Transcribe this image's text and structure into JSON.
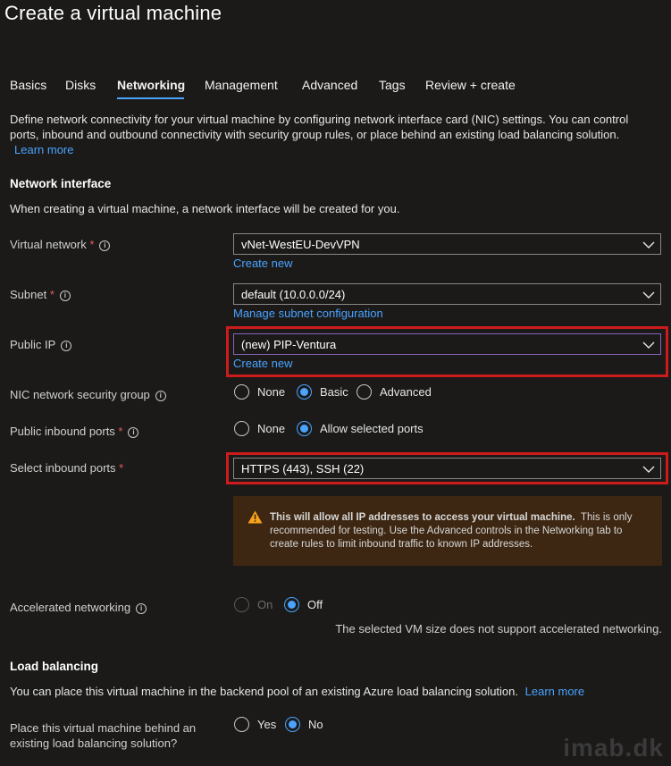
{
  "page": {
    "title": "Create a virtual machine"
  },
  "tabs": [
    {
      "label": "Basics"
    },
    {
      "label": "Disks"
    },
    {
      "label": "Networking"
    },
    {
      "label": "Management"
    },
    {
      "label": "Advanced"
    },
    {
      "label": "Tags"
    },
    {
      "label": "Review + create"
    }
  ],
  "intro": {
    "text": "Define network connectivity for your virtual machine by configuring network interface card (NIC) settings. You can control ports, inbound and outbound connectivity with security group rules, or place behind an existing load balancing solution.",
    "learn_more": "Learn more"
  },
  "network_interface": {
    "heading": "Network interface",
    "description": "When creating a virtual machine, a network interface will be created for you.",
    "virtual_network": {
      "label": "Virtual network",
      "value": "vNet-WestEU-DevVPN",
      "link": "Create new"
    },
    "subnet": {
      "label": "Subnet",
      "value": "default (10.0.0.0/24)",
      "link": "Manage subnet configuration"
    },
    "public_ip": {
      "label": "Public IP",
      "value": "(new) PIP-Ventura",
      "link": "Create new"
    },
    "nsg": {
      "label": "NIC network security group",
      "options": [
        "None",
        "Basic",
        "Advanced"
      ],
      "selected": "Basic"
    },
    "inbound_ports": {
      "label": "Public inbound ports",
      "options": [
        "None",
        "Allow selected ports"
      ],
      "selected": "Allow selected ports"
    },
    "select_ports": {
      "label": "Select inbound ports",
      "value": "HTTPS (443), SSH (22)"
    },
    "warning": {
      "bold": "This will allow all IP addresses to access your virtual machine.",
      "rest": "This is only recommended for testing.  Use the Advanced controls in the Networking tab to create rules to limit inbound traffic to known IP addresses."
    },
    "accelerated": {
      "label": "Accelerated networking",
      "options": [
        "On",
        "Off"
      ],
      "selected": "Off",
      "note": "The selected VM size does not support accelerated networking."
    }
  },
  "load_balancing": {
    "heading": "Load balancing",
    "description": "You can place this virtual machine in the backend pool of an existing Azure load balancing solution.",
    "learn_more": "Learn more",
    "place": {
      "label_line1": "Place this virtual machine behind an",
      "label_line2": "existing load balancing solution?",
      "options": [
        "Yes",
        "No"
      ],
      "selected": "No"
    }
  },
  "watermark": "imab.dk",
  "colors": {
    "accent": "#4aa3ff",
    "highlight": "#cc1b1b",
    "warning_bg": "#3d2712",
    "warning_icon": "#f7a21b"
  }
}
